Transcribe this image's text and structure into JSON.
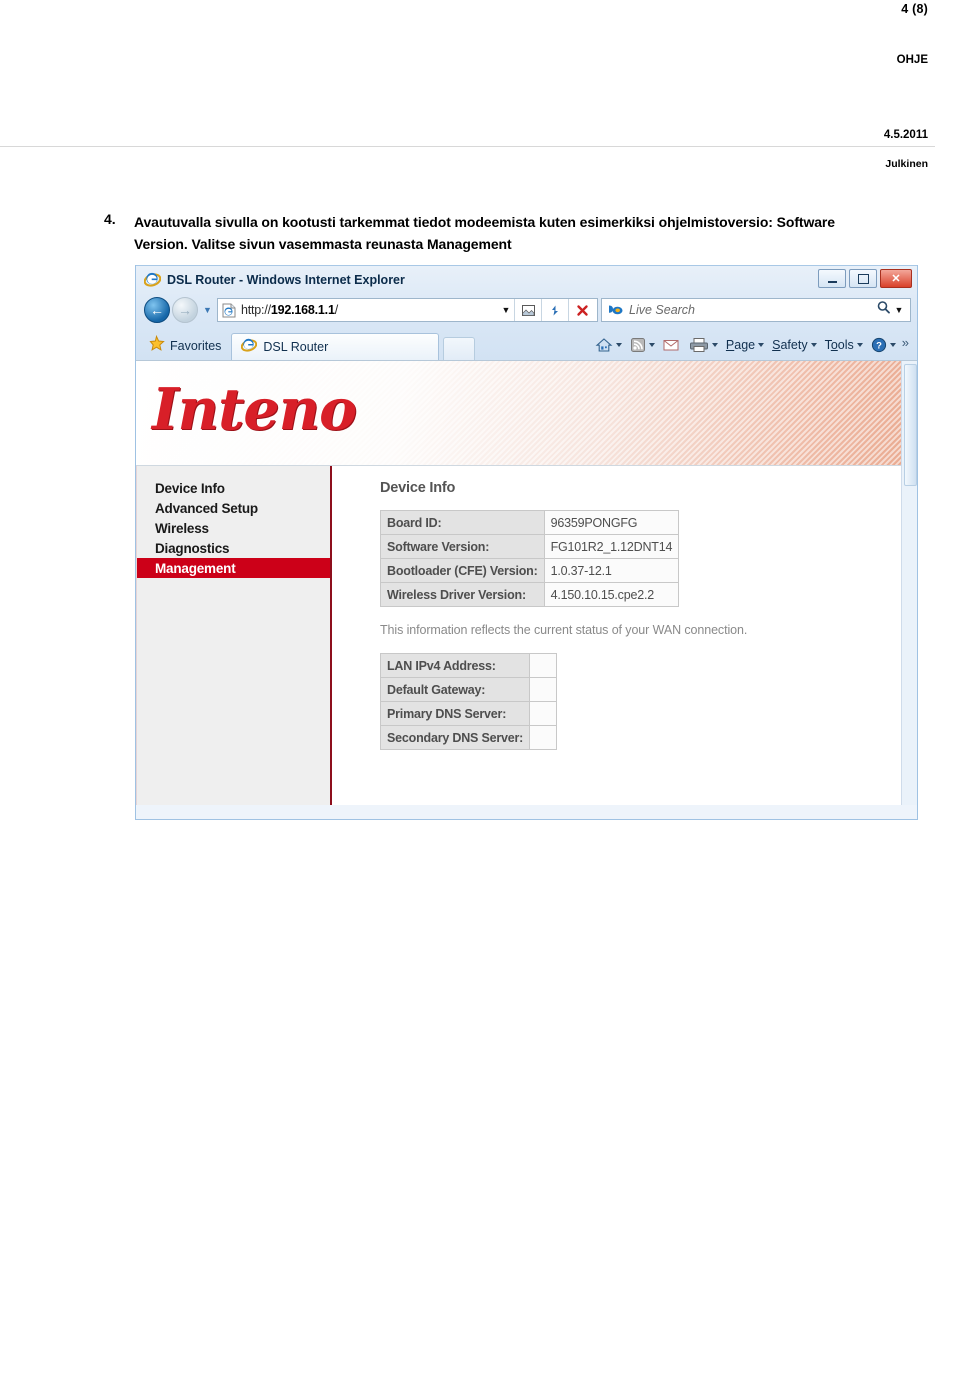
{
  "document": {
    "page_number": "4 (8)",
    "doc_kind": "OHJE",
    "date": "4.5.2011",
    "classification": "Julkinen"
  },
  "step": {
    "number": "4.",
    "text": "Avautuvalla sivulla on kootusti tarkemmat tiedot modeemista kuten esimerkiksi ohjelmistoversio: Software Version. Valitse sivun vasemmasta reunasta Management"
  },
  "browser": {
    "title": "DSL Router - Windows Internet Explorer",
    "window_buttons": {
      "minimize": "minimize-button",
      "restore": "restore-button",
      "close": "✕"
    },
    "address": {
      "url_prefix": "http://",
      "url_host": "192.168.1.1",
      "url_suffix": "/",
      "url_full": "http://192.168.1.1/"
    },
    "search": {
      "placeholder": "Live Search"
    },
    "favorites_label": "Favorites",
    "tab_label": "DSL Router",
    "command_bar": [
      {
        "label": "Page",
        "accesskey": "P",
        "has_caret": true
      },
      {
        "label": "Safety",
        "accesskey": "S",
        "has_caret": true
      },
      {
        "label": "Tools",
        "accesskey": "o",
        "has_caret": true
      }
    ],
    "overflow_label": "»"
  },
  "router_page": {
    "logo": "Inteno",
    "menu": [
      {
        "label": "Device Info",
        "active": false
      },
      {
        "label": "Advanced Setup",
        "active": false
      },
      {
        "label": "Wireless",
        "active": false
      },
      {
        "label": "Diagnostics",
        "active": false
      },
      {
        "label": "Management",
        "active": true
      }
    ],
    "heading": "Device Info",
    "device_table": [
      {
        "key": "Board ID:",
        "value": "96359PONGFG"
      },
      {
        "key": "Software Version:",
        "value": "FG101R2_1.12DNT14"
      },
      {
        "key": "Bootloader (CFE) Version:",
        "value": "1.0.37-12.1"
      },
      {
        "key": "Wireless Driver Version:",
        "value": "4.150.10.15.cpe2.2"
      }
    ],
    "note": "This information reflects the current status of your WAN connection.",
    "lan_table": [
      {
        "key": "LAN IPv4 Address:",
        "value": ""
      },
      {
        "key": "Default Gateway:",
        "value": ""
      },
      {
        "key": "Primary DNS Server:",
        "value": ""
      },
      {
        "key": "Secondary DNS Server:",
        "value": ""
      }
    ]
  },
  "colors": {
    "brand_red": "#d81f28",
    "menu_active": "#cc0018",
    "sidebar_border": "#8d0e1c"
  }
}
